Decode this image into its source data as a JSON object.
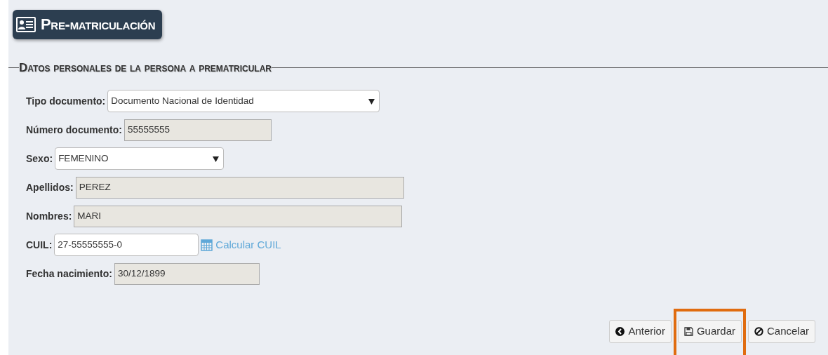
{
  "page_title": "Pre-matriculación",
  "section": {
    "legend": "Datos personales de la persona a prematricular",
    "fields": [
      {
        "label": "Tipo documento:",
        "kind": "select",
        "value": "Documento Nacional de Identidad",
        "readonly": false
      },
      {
        "label": "Número documento:",
        "kind": "input",
        "value": "55555555",
        "readonly": true
      },
      {
        "label": "Sexo:",
        "kind": "select",
        "value": "FEMENINO",
        "readonly": false
      },
      {
        "label": "Apellidos:",
        "kind": "input",
        "value": "PEREZ",
        "readonly": true
      },
      {
        "label": "Nombres:",
        "kind": "input",
        "value": "MARI",
        "readonly": true
      },
      {
        "label": "CUIL:",
        "kind": "input",
        "value": "27-55555555-0",
        "readonly": false,
        "link": "Calcular CUIL"
      },
      {
        "label": "Fecha nacimiento:",
        "kind": "input",
        "value": "30/12/1899",
        "readonly": true
      }
    ]
  },
  "buttons": [
    {
      "label": "Anterior",
      "kind": "back",
      "highlighted": false
    },
    {
      "label": "Guardar",
      "kind": "save",
      "highlighted": true
    },
    {
      "label": "Cancelar",
      "kind": "cancel",
      "highlighted": false
    }
  ]
}
